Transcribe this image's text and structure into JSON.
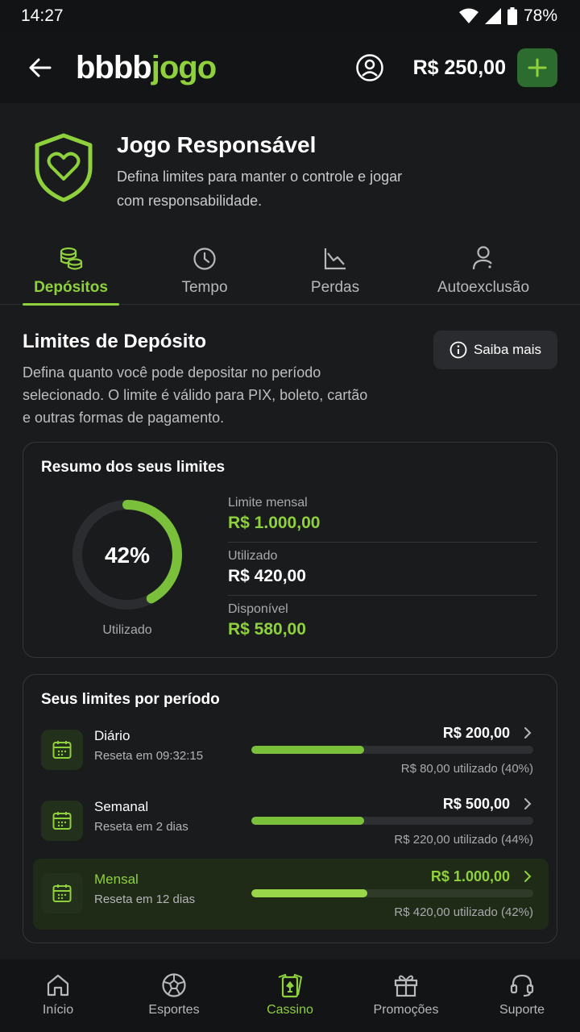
{
  "status_bar": {
    "time": "14:27",
    "battery": "78%"
  },
  "header": {
    "logo_white": "bbbb",
    "logo_green": "jogo",
    "balance": "R$ 250,00"
  },
  "hero": {
    "title": "Jogo Responsável",
    "subtitle": "Defina limites para manter o controle e jogar com responsabilidade."
  },
  "tabs": [
    {
      "label": "Depósitos",
      "icon": "coins-icon",
      "active": true
    },
    {
      "label": "Tempo",
      "icon": "clock-icon",
      "active": false
    },
    {
      "label": "Perdas",
      "icon": "chart-down-icon",
      "active": false
    },
    {
      "label": "Autoexclusão",
      "icon": "user-block-icon",
      "active": false
    }
  ],
  "section": {
    "title": "Limites de Depósito",
    "info_button": "Saiba mais",
    "description": "Defina quanto você pode depositar no período selecionado. O limite é válido para PIX, boleto, cartão e outras formas de pagamento."
  },
  "summary": {
    "title": "Resumo dos seus limites",
    "percent_text": "42%",
    "percent_value": 0.42,
    "ring_label": "Utilizado",
    "stats": [
      {
        "label": "Limite mensal",
        "value": "R$ 1.000,00"
      },
      {
        "label": "Utilizado",
        "value": "R$ 420,00"
      },
      {
        "label": "Disponível",
        "value": "R$ 580,00"
      }
    ]
  },
  "periods": {
    "title": "Seus limites por período",
    "items": [
      {
        "name": "Diário",
        "reset": "Reseta em 09:32:15",
        "amount": "R$ 200,00",
        "used": "R$ 80,00 utilizado (40%)",
        "fraction": 0.4
      },
      {
        "name": "Semanal",
        "reset": "Reseta em 2 dias",
        "amount": "R$ 500,00",
        "used": "R$ 220,00 utilizado (44%)",
        "fraction": 0.4
      },
      {
        "name": "Mensal",
        "reset": "Reseta em 12 dias",
        "amount": "R$ 1.000,00",
        "used": "R$ 420,00 utilizado (42%)",
        "fraction": 0.41
      }
    ]
  },
  "bottom_nav": [
    {
      "label": "Início",
      "icon": "home-icon"
    },
    {
      "label": "Esportes",
      "icon": "soccer-ball-icon"
    },
    {
      "label": "Cassino",
      "icon": "casino-card-icon",
      "active": true
    },
    {
      "label": "Promoções",
      "icon": "gift-icon"
    },
    {
      "label": "Suporte",
      "icon": "headset-icon"
    }
  ],
  "colors": {
    "accent": "#8fd13c",
    "bar_fill": "#7ac03a",
    "background": "#1a1b1d",
    "add_button": "#2c6d2f"
  }
}
